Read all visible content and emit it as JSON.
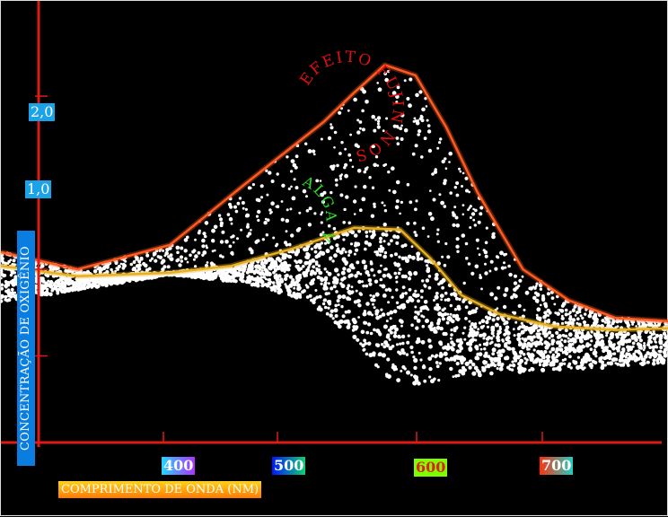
{
  "chart_data": {
    "type": "area",
    "title": "",
    "xlabel": "COMPRIMENTO DE ONDA (NM)",
    "ylabel": "CONCENTRAÇÃO DE OXIGÊNIO",
    "x_ticks": [
      "400",
      "500",
      "600",
      "700"
    ],
    "y_ticks": [
      "1,0",
      "2,0"
    ],
    "xlim": [
      290,
      725
    ],
    "ylim": [
      0,
      2.55
    ],
    "grid": false,
    "legend": "none",
    "series": [
      {
        "name": "EFEITO FUJIN NOS",
        "color": "#ff5a1f",
        "points": [
          [
            290,
            1.1
          ],
          [
            340,
            1.0
          ],
          [
            400,
            1.14
          ],
          [
            450,
            1.5
          ],
          [
            500,
            1.85
          ],
          [
            520,
            2.02
          ],
          [
            540,
            2.18
          ],
          [
            560,
            2.12
          ],
          [
            580,
            1.82
          ],
          [
            600,
            1.45
          ],
          [
            630,
            1.0
          ],
          [
            660,
            0.82
          ],
          [
            690,
            0.72
          ],
          [
            725,
            0.7
          ]
        ]
      },
      {
        "name": "ALGA VERDE",
        "color": "#e8b020",
        "points": [
          [
            290,
            1.02
          ],
          [
            340,
            0.96
          ],
          [
            400,
            0.98
          ],
          [
            440,
            1.02
          ],
          [
            480,
            1.12
          ],
          [
            520,
            1.24
          ],
          [
            550,
            1.23
          ],
          [
            570,
            1.06
          ],
          [
            590,
            0.85
          ],
          [
            615,
            0.74
          ],
          [
            650,
            0.67
          ],
          [
            690,
            0.65
          ],
          [
            725,
            0.66
          ]
        ]
      },
      {
        "name": "",
        "color": "#ffffff",
        "points": [
          [
            290,
            0.81
          ],
          [
            340,
            0.88
          ],
          [
            400,
            0.97
          ],
          [
            450,
            0.92
          ],
          [
            490,
            0.82
          ],
          [
            520,
            0.6
          ],
          [
            540,
            0.38
          ],
          [
            560,
            0.33
          ],
          [
            590,
            0.38
          ],
          [
            630,
            0.41
          ],
          [
            680,
            0.43
          ],
          [
            725,
            0.46
          ]
        ]
      }
    ],
    "annotations": [
      "EFEITO FUJIN NOS",
      "ALGA VERDE"
    ],
    "colors": {
      "axis": "#e01818",
      "background": "#000000",
      "dots": "#ffffff",
      "ytag_bg": "#1aa3e8",
      "ylabel_bg": "#0a7de0",
      "xlabel_bg_top": "#ffd21a",
      "xlabel_bg_bottom": "#ff7a00",
      "tick400": "#7ad0ff",
      "tick500": "#0033ff",
      "tick600": "#7dff00",
      "tick700": "#ff4010"
    }
  }
}
